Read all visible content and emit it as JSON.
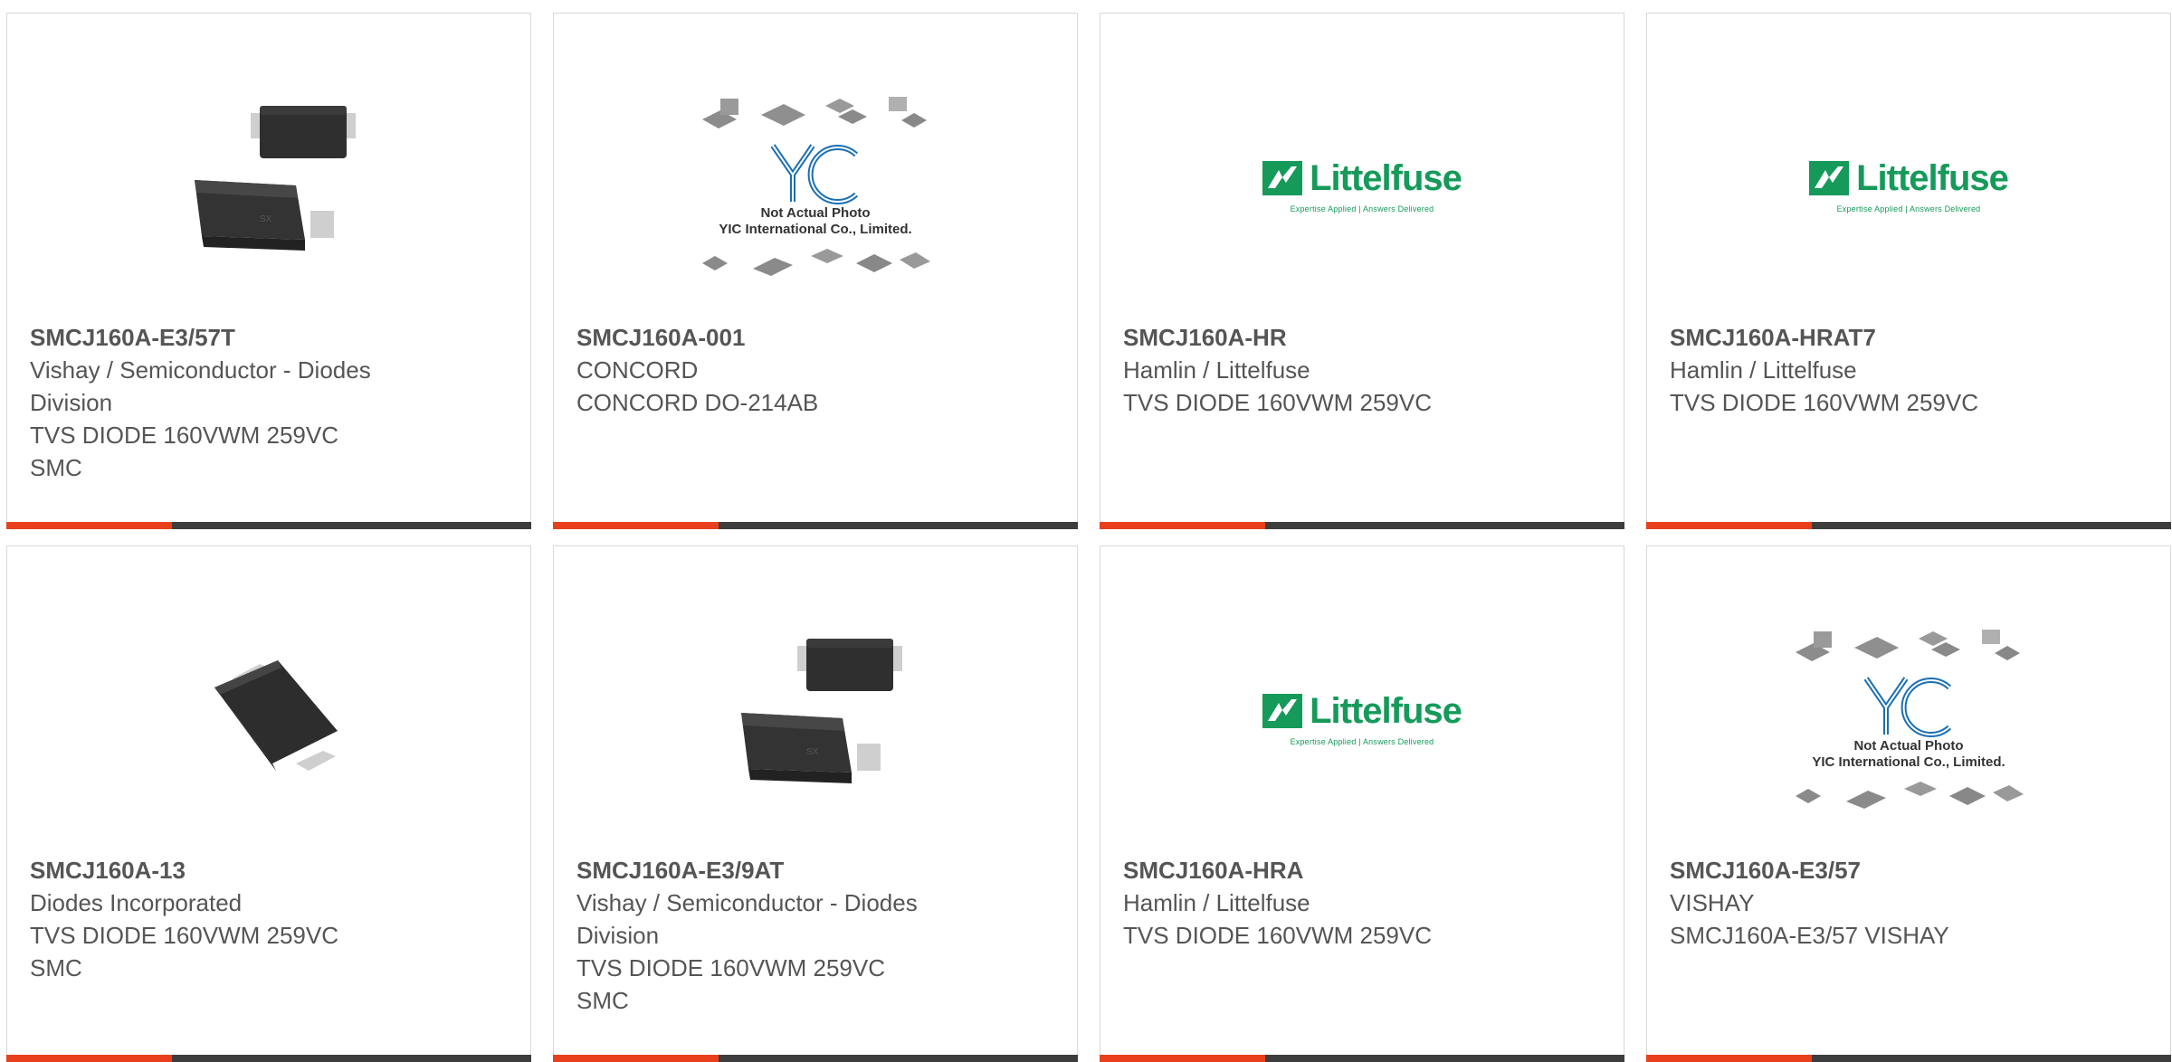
{
  "colors": {
    "accent": "#e8401c",
    "bar": "#3d3d3d",
    "text": "#555555",
    "brand_littelfuse": "#159a5a",
    "brand_yic": "#1a6fb5"
  },
  "placeholder": {
    "line1": "Not Actual Photo",
    "line2": "YIC International Co., Limited."
  },
  "littelfuse_logo": {
    "word": "Littelfuse",
    "tagline": "Expertise Applied | Answers Delivered"
  },
  "products": [
    {
      "part_number": "SMCJ160A-E3/57T",
      "manufacturer": "Vishay / Semiconductor - Diodes Division",
      "description": "TVS DIODE 160VWM 259VC",
      "package": "SMC",
      "image": "smc-diode-pair-icon"
    },
    {
      "part_number": "SMCJ160A-001",
      "manufacturer": "CONCORD",
      "description": "CONCORD DO-214AB",
      "package": "",
      "image": "yic-placeholder-icon"
    },
    {
      "part_number": "SMCJ160A-HR",
      "manufacturer": "Hamlin / Littelfuse",
      "description": "TVS DIODE 160VWM 259VC",
      "package": "",
      "image": "littelfuse-logo-icon"
    },
    {
      "part_number": "SMCJ160A-HRAT7",
      "manufacturer": "Hamlin / Littelfuse",
      "description": "TVS DIODE 160VWM 259VC",
      "package": "",
      "image": "littelfuse-logo-icon"
    },
    {
      "part_number": "SMCJ160A-13",
      "manufacturer": "Diodes Incorporated",
      "description": "TVS DIODE 160VWM 259VC",
      "package": "SMC",
      "image": "smc-diode-single-icon"
    },
    {
      "part_number": "SMCJ160A-E3/9AT",
      "manufacturer": "Vishay / Semiconductor - Diodes Division",
      "description": "TVS DIODE 160VWM 259VC",
      "package": "SMC",
      "image": "smc-diode-pair-icon"
    },
    {
      "part_number": "SMCJ160A-HRA",
      "manufacturer": "Hamlin / Littelfuse",
      "description": "TVS DIODE 160VWM 259VC",
      "package": "",
      "image": "littelfuse-logo-icon"
    },
    {
      "part_number": "SMCJ160A-E3/57",
      "manufacturer": "VISHAY",
      "description": "SMCJ160A-E3/57 VISHAY",
      "package": "",
      "image": "yic-placeholder-icon"
    }
  ]
}
